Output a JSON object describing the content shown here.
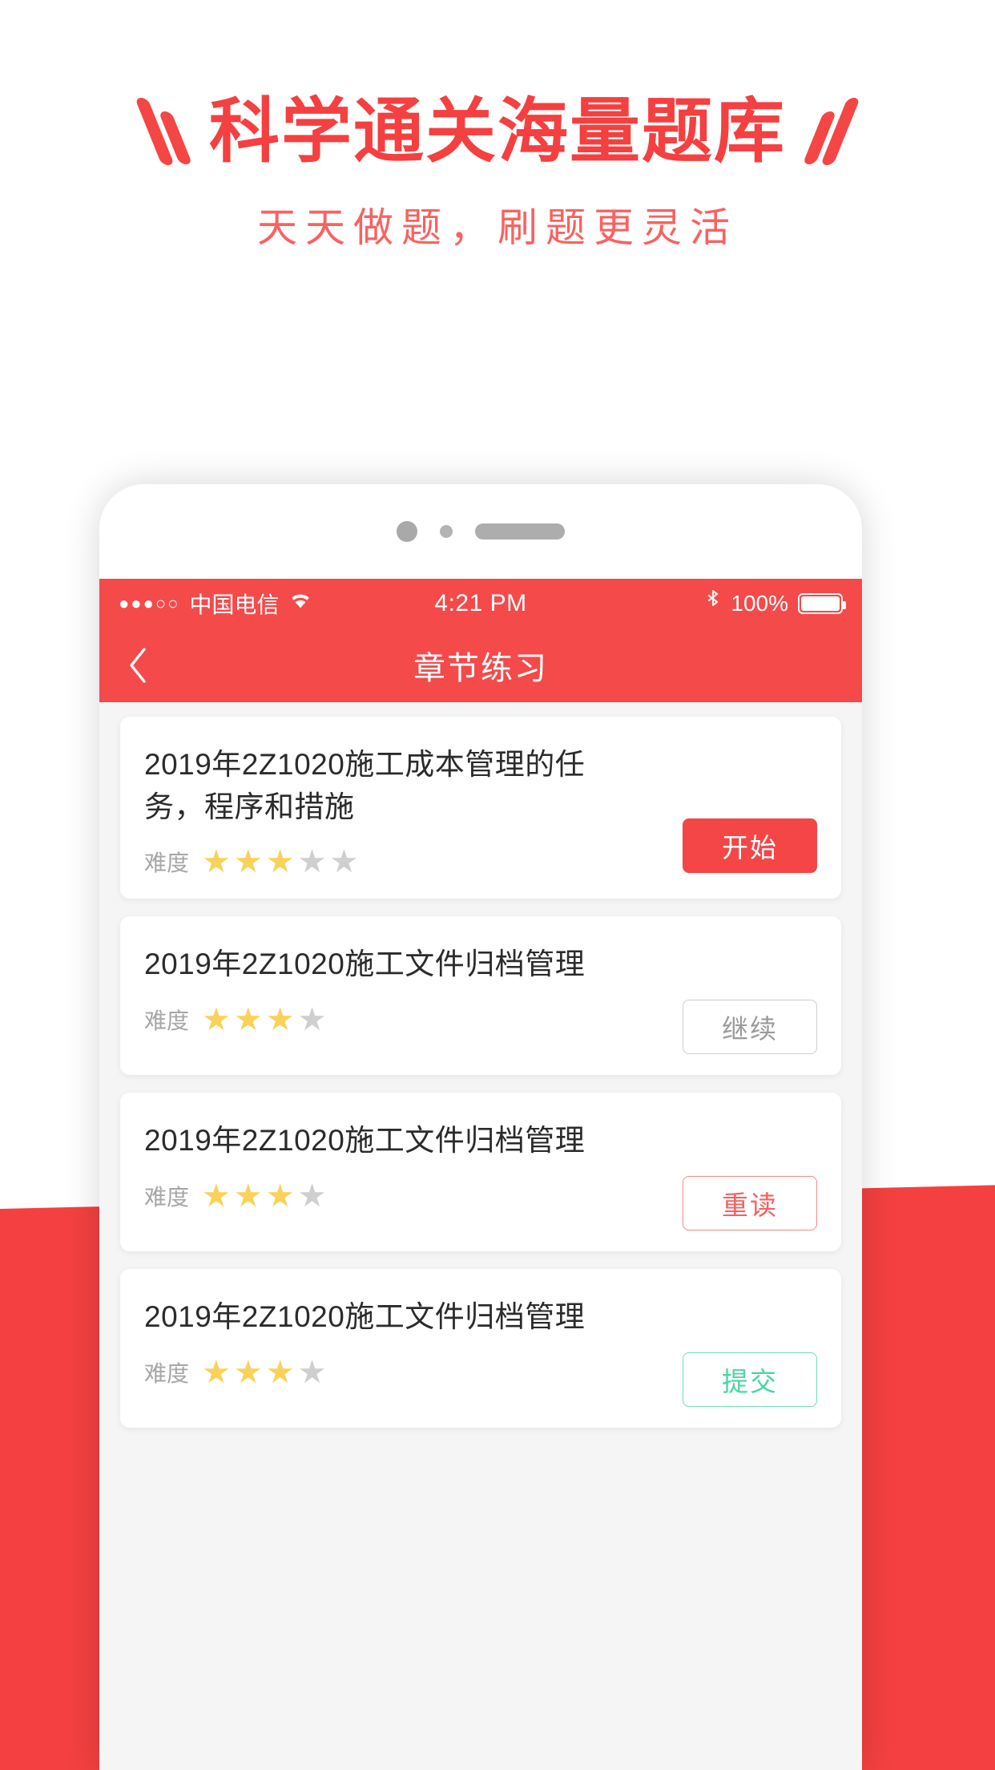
{
  "promo": {
    "headline": "科学通关海量题库",
    "subheadline": "天天做题，刷题更灵活",
    "accent_color": "#f44040",
    "sub_color": "#f9625f",
    "left_decor_icon": "double-backslash-icon",
    "right_decor_icon": "double-slash-icon"
  },
  "phone": {
    "status_bar": {
      "signal_dots": "●●●○○",
      "carrier": "中国电信",
      "wifi_icon": "wifi-icon",
      "time": "4:21 PM",
      "bluetooth_icon": "bluetooth-icon",
      "battery_percent": "100%",
      "battery_icon": "battery-full-icon",
      "background_color": "#f44a4a"
    },
    "nav_bar": {
      "back_icon": "chevron-left-icon",
      "title": "章节练习",
      "background_color": "#f44a4a"
    },
    "list": {
      "difficulty_label": "难度",
      "star_on_color": "#f9d25a",
      "star_off_color": "#cfcfcf",
      "items": [
        {
          "title": "2019年2Z1020施工成本管理的任务，程序和措施",
          "stars_filled": 3,
          "stars_total": 5,
          "action_label": "开始",
          "action_style": "solid-red"
        },
        {
          "title": "2019年2Z1020施工文件归档管理",
          "stars_filled": 3,
          "stars_total": 4,
          "action_label": "继续",
          "action_style": "outline-gray"
        },
        {
          "title": "2019年2Z1020施工文件归档管理",
          "stars_filled": 3,
          "stars_total": 4,
          "action_label": "重读",
          "action_style": "outline-red"
        },
        {
          "title": "2019年2Z1020施工文件归档管理",
          "stars_filled": 3,
          "stars_total": 4,
          "action_label": "提交",
          "action_style": "outline-green"
        }
      ]
    }
  },
  "background": {
    "band_color": "#f44040"
  }
}
